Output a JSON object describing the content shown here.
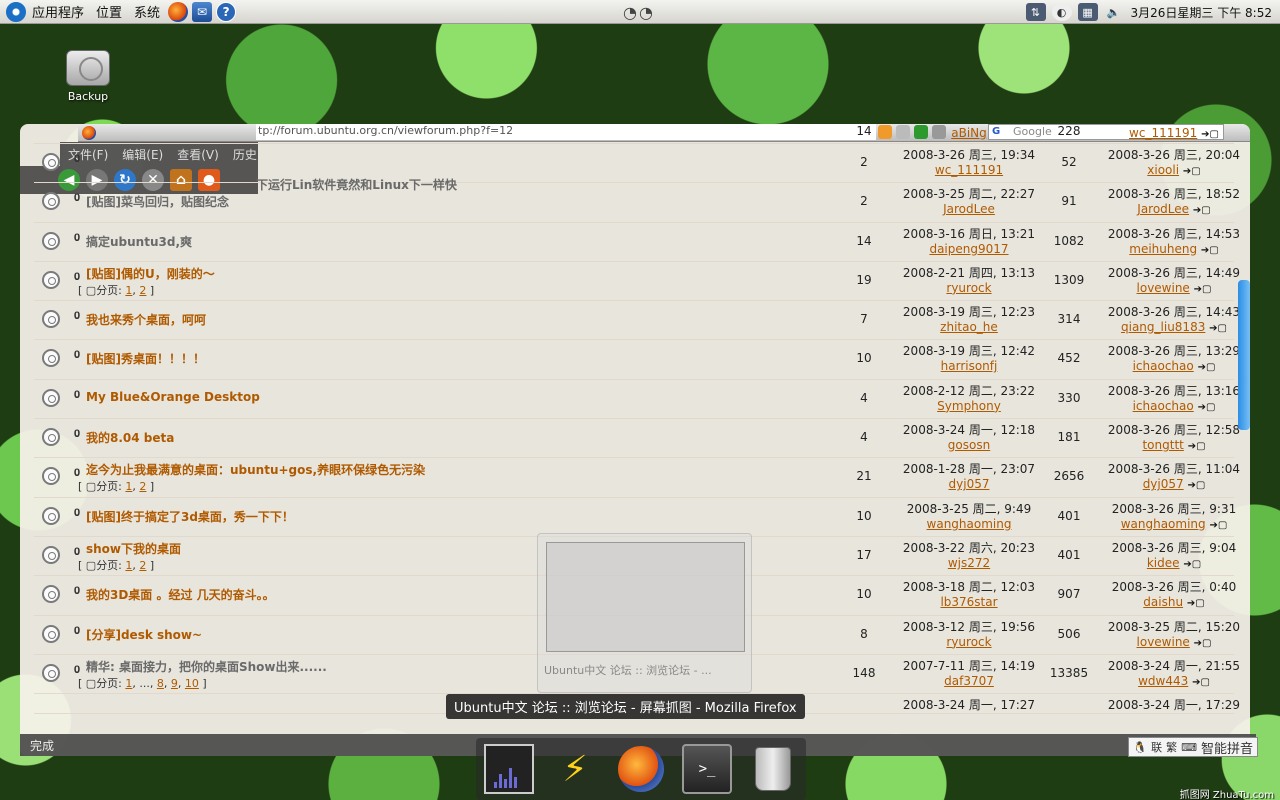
{
  "panel": {
    "menus": [
      "应用程序",
      "位置",
      "系统"
    ],
    "clock": "3月26日星期三 下午 8:52"
  },
  "desktop": {
    "icons": [
      {
        "label": "Backup"
      }
    ]
  },
  "browser": {
    "url": "tp://forum.ubuntu.org.cn/viewforum.php?f=12",
    "search_placeholder": "Google",
    "menu": [
      "文件(F)",
      "编辑(E)",
      "查看(V)",
      "历史"
    ],
    "status": "完成",
    "partial_top_title": "下运行Lin软件竟然和Linux下一样快"
  },
  "forum": {
    "rows": [
      {
        "title": "",
        "replies": "2",
        "author_date": "2008-3-26 周三, 19:34",
        "author": "wc_111191",
        "views": "52",
        "last_date": "2008-3-26 周三, 20:04",
        "last_user": "xiooli",
        "grey": false,
        "pages": []
      },
      {
        "title": "[贴图]菜鸟回归，贴图纪念",
        "replies": "2",
        "author_date": "2008-3-25 周二, 22:27",
        "author": "JarodLee",
        "views": "91",
        "last_date": "2008-3-26 周三, 18:52",
        "last_user": "JarodLee",
        "grey": true,
        "pages": []
      },
      {
        "title": "搞定ubuntu3d,爽",
        "replies": "14",
        "author_date": "2008-3-16 周日, 13:21",
        "author": "daipeng9017",
        "views": "1082",
        "last_date": "2008-3-26 周三, 14:53",
        "last_user": "meihuheng",
        "grey": true,
        "pages": []
      },
      {
        "title": "[贴图]偶的U，刚装的～",
        "replies": "19",
        "author_date": "2008-2-21 周四, 13:13",
        "author": "ryurock",
        "views": "1309",
        "last_date": "2008-3-26 周三, 14:49",
        "last_user": "lovewine",
        "grey": false,
        "pages": [
          "1",
          "2"
        ]
      },
      {
        "title": "我也来秀个桌面，呵呵",
        "replies": "7",
        "author_date": "2008-3-19 周三, 12:23",
        "author": "zhitao_he",
        "views": "314",
        "last_date": "2008-3-26 周三, 14:43",
        "last_user": "qiang_liu8183",
        "grey": false,
        "pages": []
      },
      {
        "title": "[贴图]秀桌面！！！！",
        "replies": "10",
        "author_date": "2008-3-19 周三, 12:42",
        "author": "harrisonfj",
        "views": "452",
        "last_date": "2008-3-26 周三, 13:29",
        "last_user": "ichaochao",
        "grey": false,
        "pages": []
      },
      {
        "title": "My Blue&Orange Desktop",
        "replies": "4",
        "author_date": "2008-2-12 周二, 23:22",
        "author": "Symphony",
        "views": "330",
        "last_date": "2008-3-26 周三, 13:16",
        "last_user": "ichaochao",
        "grey": false,
        "pages": []
      },
      {
        "title": "我的8.04 beta",
        "replies": "4",
        "author_date": "2008-3-24 周一, 12:18",
        "author": "gososn",
        "views": "181",
        "last_date": "2008-3-26 周三, 12:58",
        "last_user": "tongttt",
        "grey": false,
        "pages": []
      },
      {
        "title": "迄今为止我最满意的桌面：ubuntu+gos,养眼环保绿色无污染",
        "replies": "21",
        "author_date": "2008-1-28 周一, 23:07",
        "author": "dyj057",
        "views": "2656",
        "last_date": "2008-3-26 周三, 11:04",
        "last_user": "dyj057",
        "grey": false,
        "pages": [
          "1",
          "2"
        ]
      },
      {
        "title": "[贴图]终于搞定了3d桌面，秀一下下！",
        "replies": "10",
        "author_date": "2008-3-25 周二, 9:49",
        "author": "wanghaoming",
        "views": "401",
        "last_date": "2008-3-26 周三, 9:31",
        "last_user": "wanghaoming",
        "grey": false,
        "pages": []
      },
      {
        "title": "show下我的桌面",
        "replies": "17",
        "author_date": "2008-3-22 周六, 20:23",
        "author": "wjs272",
        "views": "401",
        "last_date": "2008-3-26 周三, 9:04",
        "last_user": "kidee",
        "grey": false,
        "pages": [
          "1",
          "2"
        ]
      },
      {
        "title": "我的3D桌面 。经过 几天的奋斗。。",
        "replies": "10",
        "author_date": "2008-3-18 周二, 12:03",
        "author": "lb376star",
        "views": "907",
        "last_date": "2008-3-26 周三, 0:40",
        "last_user": "daishu",
        "grey": false,
        "pages": []
      },
      {
        "title": "[分享]desk show~",
        "replies": "8",
        "author_date": "2008-3-12 周三, 19:56",
        "author": "ryurock",
        "views": "506",
        "last_date": "2008-3-25 周二, 15:20",
        "last_user": "lovewine",
        "grey": false,
        "pages": []
      },
      {
        "title": "精华: 桌面接力，把你的桌面Show出来......",
        "replies": "148",
        "author_date": "2007-7-11 周三, 14:19",
        "author": "daf3707",
        "views": "13385",
        "last_date": "2008-3-24 周一, 21:55",
        "last_user": "wdw443",
        "grey": true,
        "pages": [
          "1",
          "...",
          "8",
          "9",
          "10"
        ]
      }
    ],
    "top_partial": {
      "replies": "14",
      "author": "aBiNg",
      "views": "228",
      "last_user": "wc_111191"
    },
    "bottom_partial": {
      "author_date": "2008-3-24 周一, 17:27",
      "last_date": "2008-3-24 周一, 17:29"
    },
    "pages_label": "分页:"
  },
  "tooltip": "Ubuntu中文 论坛 :: 浏览论坛 - 屏幕抓图 - Mozilla Firefox",
  "preview_label": "Ubuntu中文 论坛 :: 浏览论坛 - ...",
  "ime": {
    "label": "智能拼音",
    "buttons": [
      "联",
      "繁"
    ]
  },
  "watermark": "抓图网 ZhuaTu.com"
}
